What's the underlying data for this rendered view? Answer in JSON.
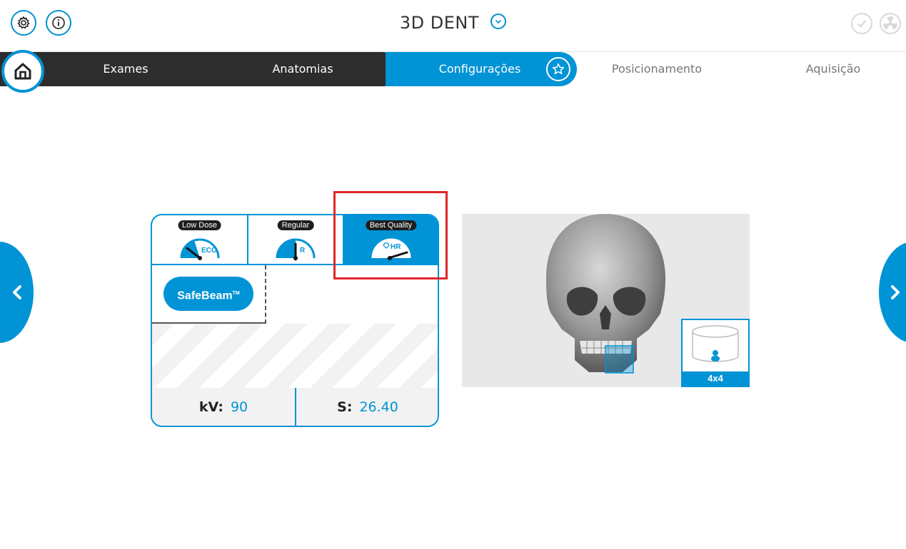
{
  "header": {
    "title": "3D DENT",
    "settings_icon": "gear-icon",
    "info_icon": "info-icon",
    "right_icons": [
      "check-circle-icon",
      "radiation-icon"
    ]
  },
  "nav": {
    "items": [
      {
        "label": "Exames"
      },
      {
        "label": "Anatomias"
      },
      {
        "label": "Configurações"
      },
      {
        "label": "Posicionamento"
      },
      {
        "label": "Aquisição"
      }
    ],
    "active": "Configurações"
  },
  "quality": {
    "tabs": [
      {
        "label": "Low Dose",
        "gauge": "ECO"
      },
      {
        "label": "Regular",
        "gauge": "R"
      },
      {
        "label": "Best Quality",
        "gauge": "HR"
      }
    ],
    "selected": "Best Quality",
    "safebeam_label": "SafeBeam",
    "safebeam_tm": "TM",
    "kv_label": "kV:",
    "kv_value": "90",
    "s_label": "S:",
    "s_value": "26.40"
  },
  "preview": {
    "fov_label": "4x4"
  },
  "colors": {
    "accent": "#0093d6",
    "dark": "#2d2d2d",
    "highlight": "#e0262a"
  }
}
